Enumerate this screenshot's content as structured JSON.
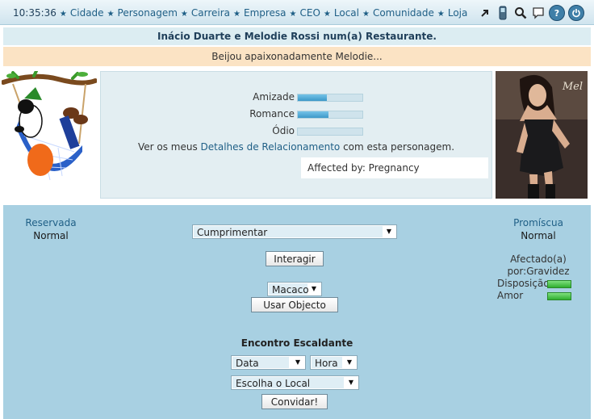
{
  "nav": {
    "time": "10:35:36",
    "items": [
      "Cidade",
      "Personagem",
      "Carreira",
      "Empresa",
      "CEO",
      "Local",
      "Comunidade",
      "Loja"
    ]
  },
  "toolbar_icons": [
    "arrow-icon",
    "phone-icon",
    "search-icon",
    "chat-icon",
    "help-icon",
    "power-icon"
  ],
  "header": {
    "title": "Inácio Duarte e Melodie Rossi num(a) Restaurante.",
    "action": "Beijou apaixonadamente Melodie..."
  },
  "right_portrait": {
    "label": "Mel"
  },
  "relationship": {
    "metrics": [
      {
        "label": "Amizade",
        "fill": 0.45
      },
      {
        "label": "Romance",
        "fill": 0.48
      },
      {
        "label": "Ódio",
        "fill": 0.0
      }
    ],
    "details_prefix": "Ver os meus",
    "details_link": "Detalhes de Relacionamento",
    "details_suffix": "com esta personagem.",
    "affected": "Affected by: Pregnancy"
  },
  "left_status": {
    "label": "Reservada",
    "value": "Normal"
  },
  "right_status": {
    "label": "Promíscua",
    "value": "Normal",
    "affected_line1": "Afectado(a)",
    "affected_line2": "por:Gravidez",
    "mood1": "Disposição",
    "mood2": "Amor"
  },
  "interaction": {
    "select_value": "Cumprimentar",
    "interact_button": "Interagir",
    "object_select": "Macaco",
    "object_button": "Usar Objecto"
  },
  "date": {
    "title": "Encontro Escaldante",
    "date_select": "Data",
    "hour_select": "Hora",
    "place_select": "Escolha o Local",
    "invite_button": "Convidar!"
  },
  "colors": {
    "link": "#1f5f86",
    "panel": "#e3eef2",
    "lower": "#a8d0e2",
    "action_bg": "#fbe3c4",
    "bar_fill": "#3d98c8",
    "mood_fill": "#2fae2f"
  }
}
